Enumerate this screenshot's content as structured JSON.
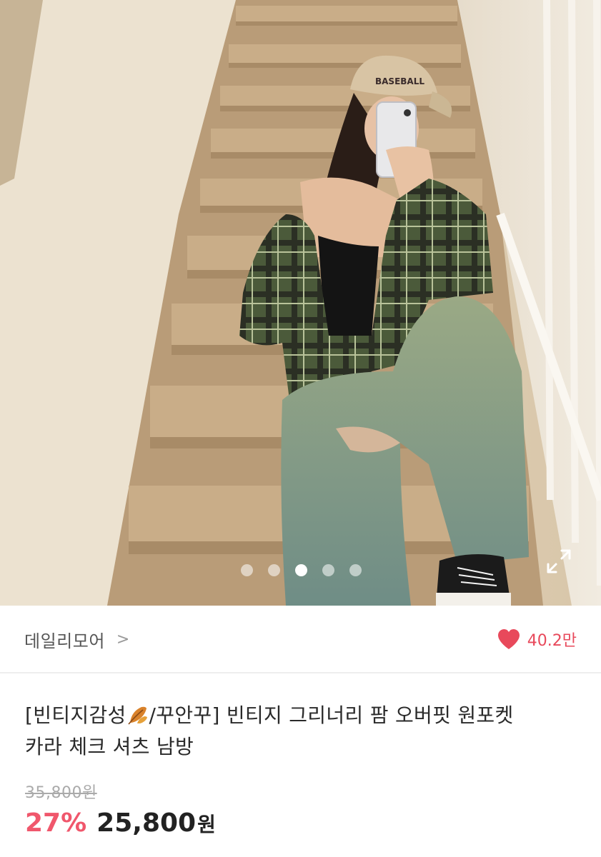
{
  "hero": {
    "image_alt": "product photo",
    "carousel": {
      "count": 5,
      "active_index": 2
    },
    "expand_icon": "expand-arrows-icon"
  },
  "store": {
    "name": "데일리모어",
    "chevron": ">",
    "like_icon": "heart-icon",
    "like_count": "40.2만",
    "like_color": "#e8495b"
  },
  "product": {
    "title_part1": "[빈티지감성",
    "title_icon": "autumn-leaf-icon",
    "title_part2": "/꾸안꾸] 빈티지 그리너리 팜 오버핏 원포켓",
    "title_line2": "카라 체크 셔츠 남방",
    "original_price": "35,800원",
    "discount": "27%",
    "sale_price": "25,800",
    "currency": "원",
    "discount_color": "#f0576c"
  }
}
